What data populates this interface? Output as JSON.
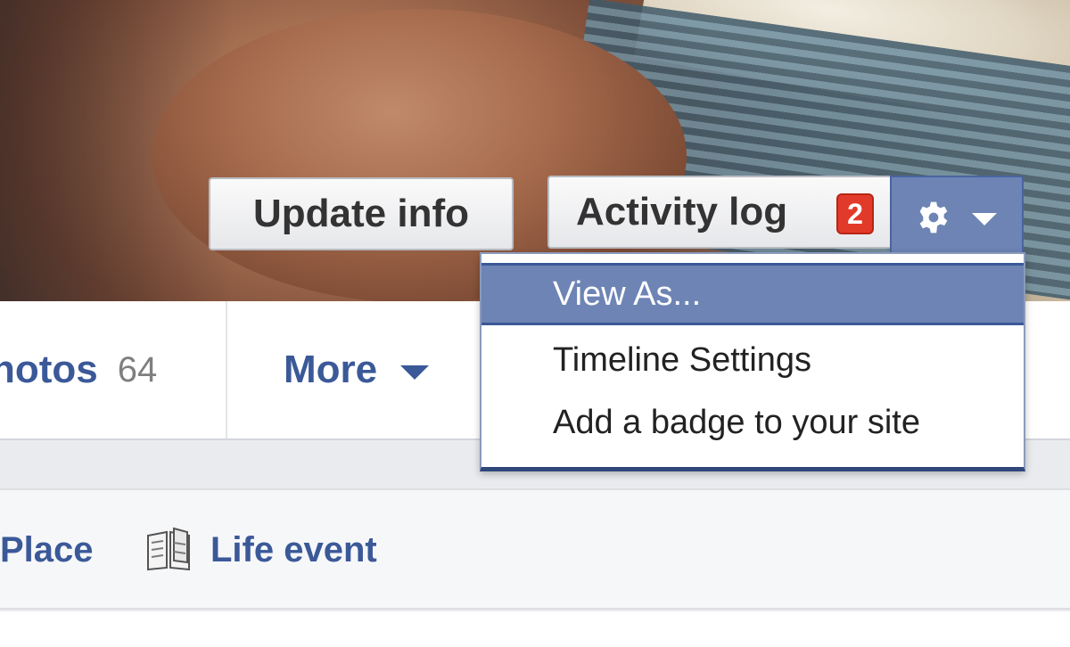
{
  "cover": {
    "update_info_label": "Update info",
    "activity_log_label": "Activity log",
    "activity_badge_count": "2",
    "gear_icon": "gear-icon",
    "caret_icon": "caret-down-icon",
    "colors": {
      "menu_blue": "#6d84b4",
      "badge_red": "#e23a2a",
      "link_blue": "#3b5998"
    }
  },
  "tabs": {
    "photos_label": "hotos",
    "photos_count": "64",
    "more_label": "More"
  },
  "menu": {
    "items": [
      {
        "label": "View As..."
      },
      {
        "label": "Timeline Settings"
      },
      {
        "label": "Add a badge to your site"
      }
    ]
  },
  "composer": {
    "place_label": "Place",
    "life_event_label": "Life event",
    "life_event_icon": "book-icon"
  }
}
